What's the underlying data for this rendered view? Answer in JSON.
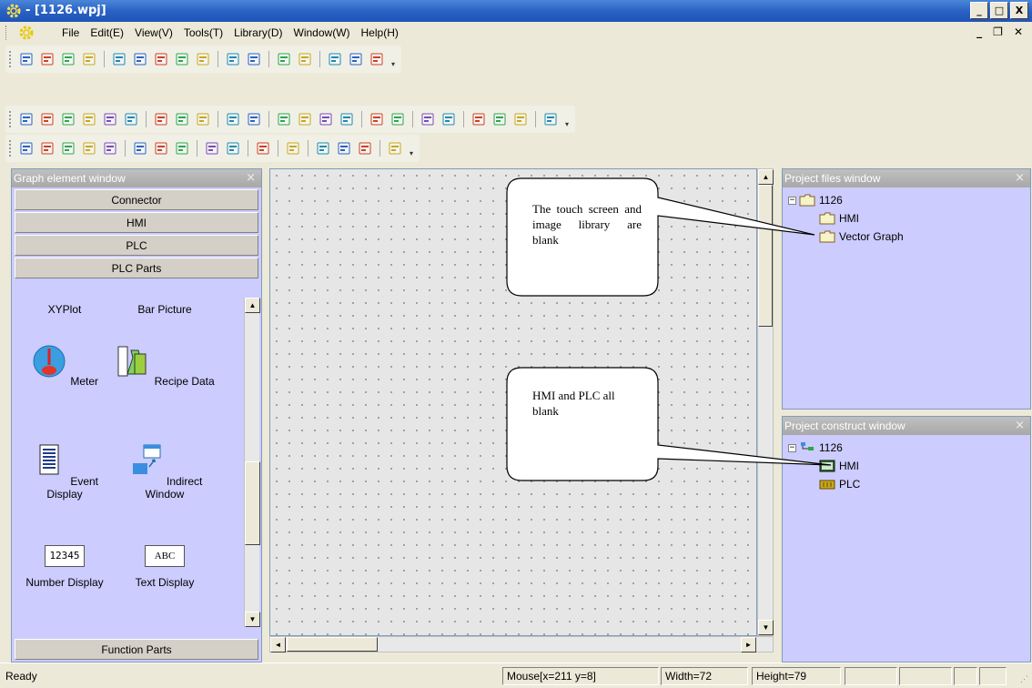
{
  "window": {
    "title": "- [1126.wpj]",
    "minimize": "_",
    "maximize": "□",
    "close": "X"
  },
  "menu": {
    "items": [
      "File",
      "Edit(E)",
      "View(V)",
      "Tools(T)",
      "Library(D)",
      "Window(W)",
      "Help(H)"
    ],
    "mdi_minimize": "_",
    "mdi_restore": "❐",
    "mdi_close": "✕"
  },
  "toolbars": {
    "row1": [
      "new-icon",
      "open-icon",
      "save-icon",
      "save-all-icon",
      "|",
      "cut-icon",
      "copy-icon",
      "paste-icon",
      "paste-special-icon",
      "delete-icon",
      "|",
      "undo-icon",
      "redo-icon",
      "|",
      "print-preview-icon",
      "print-icon",
      "|",
      "compile-icon",
      "select-icon",
      "help-icon"
    ],
    "row2": [
      "align-left-icon",
      "align-center-icon",
      "align-right-icon",
      "align-top-icon",
      "align-middle-icon",
      "align-bottom-icon",
      "|",
      "same-width-icon",
      "same-height-icon",
      "same-size-icon",
      "|",
      "h-space-icon",
      "v-space-icon",
      "|",
      "bring-front-icon",
      "send-back-icon",
      "forward-icon",
      "backward-icon",
      "|",
      "group-icon",
      "ungroup-icon",
      "|",
      "h-line-icon",
      "v-line-icon",
      "|",
      "flip-icon",
      "rotate-icon",
      "mirror-icon",
      "|",
      "lock-icon"
    ],
    "row3": [
      "screen-icon",
      "grid-icon",
      "layer-icon",
      "property-icon",
      "database-icon",
      "|",
      "run-icon",
      "simulate-icon",
      "window-icon",
      "|",
      "page-icon",
      "bitmap-icon",
      "|",
      "connect-icon",
      "|",
      "download-icon",
      "|",
      "trend-icon",
      "alarm-icon",
      "recipe-icon",
      "|",
      "plc-icon"
    ]
  },
  "graph_panel": {
    "title": "Graph element window",
    "close": "×",
    "categories": [
      "Connector",
      "HMI",
      "PLC",
      "PLC Parts"
    ],
    "parts": [
      {
        "label": "XYPlot",
        "icon": "xyplot-icon"
      },
      {
        "label": "Bar Picture",
        "icon": "bar-picture-icon"
      },
      {
        "label": "Meter",
        "icon": "meter-icon"
      },
      {
        "label": "Recipe Data",
        "icon": "recipe-data-icon"
      },
      {
        "label": "Event Display",
        "icon": "event-display-icon"
      },
      {
        "label": "Indirect Window",
        "icon": "indirect-window-icon"
      },
      {
        "label": "Number Display",
        "icon": "number-display-icon",
        "sample": "12345"
      },
      {
        "label": "Text Display",
        "icon": "text-display-icon",
        "sample": "ABC"
      }
    ],
    "bottom_category": "Function Parts"
  },
  "project_files": {
    "title": "Project files window",
    "close": "×",
    "root": "1126",
    "children": [
      "HMI",
      "Vector Graph"
    ]
  },
  "project_construct": {
    "title": "Project construct window",
    "close": "×",
    "root": "1126",
    "children": [
      "HMI",
      "PLC"
    ]
  },
  "callouts": {
    "top": "The touch screen and image library are blank",
    "bottom": "HMI and PLC all blank"
  },
  "status": {
    "ready": "Ready",
    "mouse": "Mouse[x=211  y=8]",
    "width": "Width=72",
    "height": "Height=79"
  },
  "colors": {
    "titlebar": "#2a62c4",
    "panel_bg": "#ccccff",
    "canvas_bg": "#e6e6e6",
    "chrome": "#ece9d8"
  }
}
